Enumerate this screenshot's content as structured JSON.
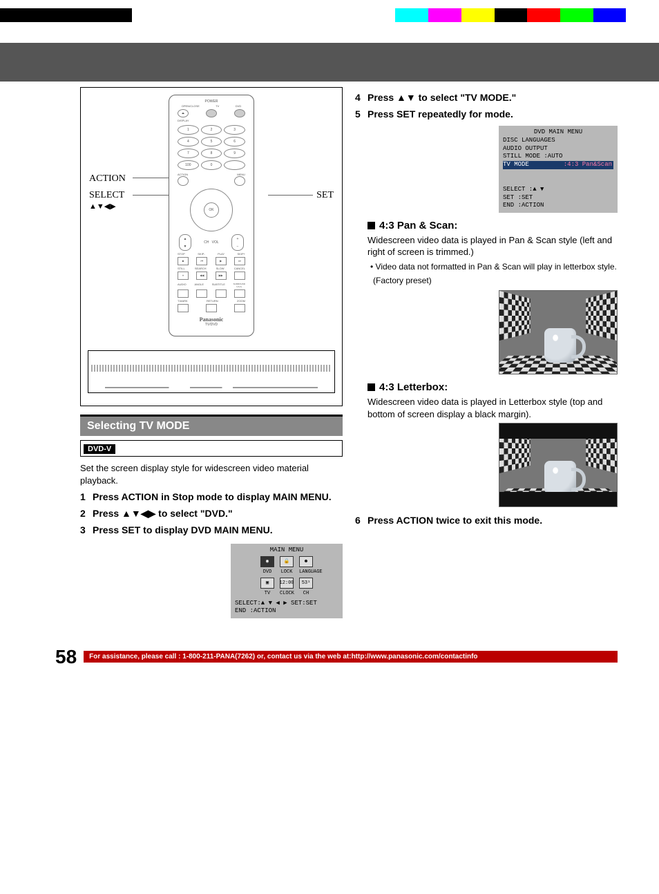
{
  "header": {
    "blank": ""
  },
  "remote": {
    "labels": {
      "action": "ACTION",
      "select": "SELECT",
      "select_arrows": "▲▼◀▶",
      "set": "SET"
    },
    "brand": "Panasonic",
    "brand_sub": "TV/DVD"
  },
  "section": {
    "title": "Selecting TV MODE",
    "badge": "DVD-V",
    "intro": "Set the screen display style for widescreen video material playback."
  },
  "steps_left": [
    {
      "n": "1",
      "t": "Press ACTION in Stop mode to display MAIN MENU."
    },
    {
      "n": "2",
      "t": "Press ▲▼◀▶ to select \"DVD.\""
    },
    {
      "n": "3",
      "t": "Press SET to display DVD MAIN MENU."
    }
  ],
  "main_menu_osd": {
    "title": "MAIN MENU",
    "row1_labels": [
      "DVD",
      "LOCK",
      "LANGUAGE"
    ],
    "row2_labels": [
      "TV",
      "CLOCK",
      "CH"
    ],
    "row2_icon_ch": "53¹",
    "row2_icon_clock": "12:00",
    "footer1": "SELECT:▲ ▼ ◀ ▶   SET:SET",
    "footer2": "END   :ACTION"
  },
  "steps_right_top": [
    {
      "n": "4",
      "t": "Press ▲▼ to select \"TV MODE.\""
    },
    {
      "n": "5",
      "t": "Press SET repeatedly for mode."
    }
  ],
  "dvd_menu_osd": {
    "title": "DVD MAIN MENU",
    "lines": [
      "DISC LANGUAGES",
      "AUDIO OUTPUT"
    ],
    "still": "STILL MODE     :AUTO",
    "hl_label": "TV MODE",
    "hl_value": ":4:3 Pan&Scan",
    "footer_select": "SELECT   :▲ ▼",
    "footer_set": "SET      :SET",
    "footer_end": "END      :ACTION"
  },
  "pan_scan": {
    "title": "4:3 Pan & Scan:",
    "body": "Widescreen video data is played in Pan & Scan style (left and right of screen is trimmed.)",
    "note": "Video data not formatted in Pan & Scan will play in letterbox style.",
    "preset": "(Factory preset)"
  },
  "letterbox": {
    "title": "4:3 Letterbox:",
    "body": "Widescreen video data is played in Letterbox style (top and bottom of screen display a black margin)."
  },
  "steps_right_bottom": [
    {
      "n": "6",
      "t": "Press ACTION twice to exit this mode."
    }
  ],
  "footer": {
    "page": "58",
    "assist": "For assistance, please call : 1-800-211-PANA(7262) or, contact us via the web at:http://www.panasonic.com/contactinfo"
  },
  "calbar_colors_top": [
    "#000",
    "#000",
    "#000",
    "#000",
    "#fff",
    "#fff",
    "#fff",
    "#fff",
    "#fff",
    "#fff",
    "#fff",
    "#fff",
    "#0ff",
    "#f0f",
    "#ff0",
    "#000",
    "#f00",
    "#0f0",
    "#00f",
    "#fff"
  ],
  "calbar_colors_full": []
}
